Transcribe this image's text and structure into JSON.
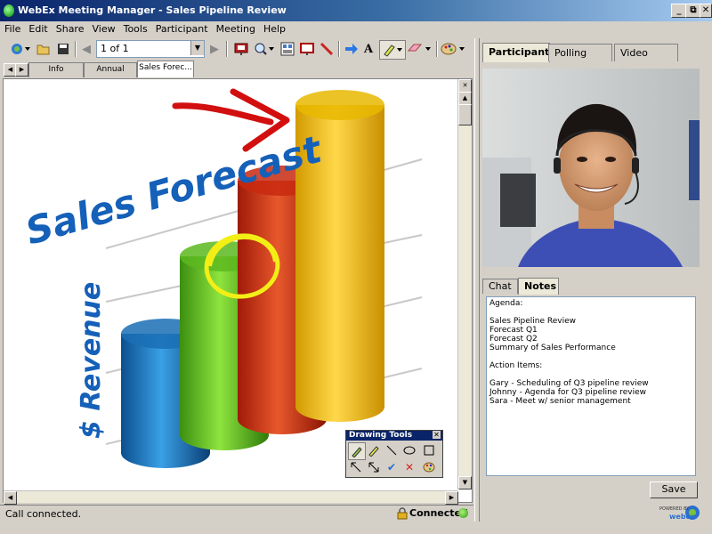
{
  "window": {
    "title": "WebEx Meeting Manager - Sales Pipeline Review",
    "minimize": "_",
    "restore": "⧉",
    "close": "✕"
  },
  "menu": [
    "File",
    "Edit",
    "Share",
    "View",
    "Tools",
    "Participant",
    "Meeting",
    "Help"
  ],
  "toolbar": {
    "page_indicator": "1 of 1",
    "icons": [
      "participant-icon",
      "open-folder-icon",
      "save-icon",
      "prev-page-icon",
      "next-page-icon",
      "presentation-icon",
      "zoom-icon",
      "thumbnails-icon",
      "whiteboard-icon",
      "pointer-pen-icon",
      "arrow-pointer-icon",
      "text-icon",
      "highlighter-icon",
      "eraser-icon",
      "palette-icon"
    ]
  },
  "doc_tabs": [
    "Info",
    "Annual Report",
    "Sales Forec..."
  ],
  "slide": {
    "title": "Sales Forecast",
    "axis_label": "$ Revenue",
    "bars": [
      {
        "color": "#1a6fb5",
        "value": 0.36
      },
      {
        "color": "#5cb81f",
        "value": 0.54
      },
      {
        "color": "#c8290f",
        "value": 0.72
      },
      {
        "color": "#e8b800",
        "value": 0.91
      }
    ],
    "colors": {
      "arrow": "#d20f0f",
      "circle": "#f3ef16"
    }
  },
  "drawing_tools": {
    "title": "Drawing Tools",
    "tools": [
      "pencil-icon",
      "highlighter-icon",
      "line-icon",
      "ellipse-icon",
      "rectangle-icon",
      "arrow-icon",
      "double-arrow-icon",
      "checkmark-icon",
      "x-mark-icon",
      "palette-icon"
    ]
  },
  "right_tabs": [
    "Participants",
    "Polling",
    "Video"
  ],
  "note_tabs": [
    "Chat",
    "Notes"
  ],
  "notes_text": "Agenda:\n\nSales Pipeline Review\nForecast Q1\nForecast Q2\nSummary of Sales Performance\n\nAction Items:\n\nGary - Scheduling of Q3 pipeline review\nJohnny - Agenda for Q3 pipeline review\nSara - Meet w/ senior management",
  "save_label": "Save",
  "status": {
    "text": "Call connected.",
    "connection": "Connected"
  },
  "badge": {
    "powered_by": "POWERED BY",
    "brand": "webex"
  }
}
